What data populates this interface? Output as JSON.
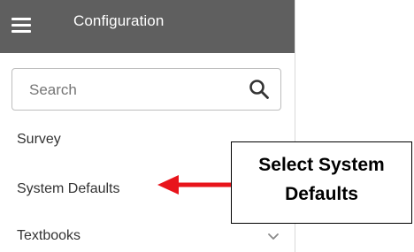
{
  "header": {
    "title": "Configuration",
    "menu_icon": "hamburger-menu-icon"
  },
  "search": {
    "placeholder": "Search",
    "value": "",
    "icon": "search-icon"
  },
  "nav": {
    "items": [
      {
        "label": "Survey"
      },
      {
        "label": "System Defaults"
      },
      {
        "label": "Textbooks",
        "icon": "chevron-down-icon"
      }
    ]
  },
  "annotation": {
    "lines": [
      "Select System",
      "Defaults"
    ],
    "arrow_color": "#e8141b",
    "arrow_icon": "left-arrow-icon"
  },
  "colors": {
    "header_bg": "#5f5f5f",
    "header_text": "#ffffff",
    "arrow": "#e8141b"
  }
}
